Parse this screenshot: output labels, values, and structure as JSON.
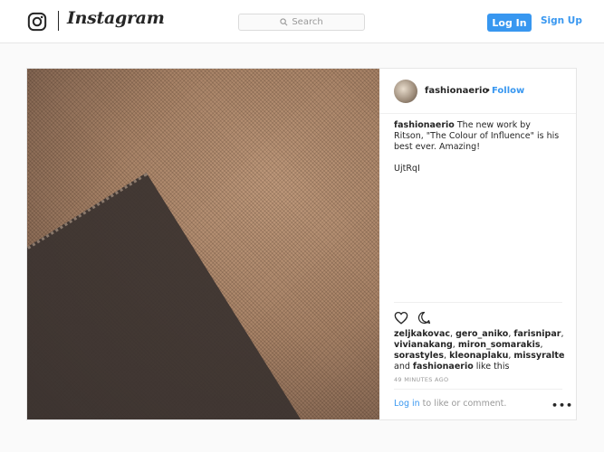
{
  "header": {
    "logo_icon": "instagram-camera-icon",
    "wordmark": "Instagram",
    "search_placeholder": "Search",
    "search_icon": "search-icon",
    "login_label": "Log In",
    "signup_label": "Sign Up"
  },
  "post": {
    "username": "fashionaerio",
    "dot": "•",
    "follow_label": "Follow",
    "caption_user": "fashionaerio",
    "caption_text": " The new work by Ritson, \"The Colour of Influence\" is his best ever. Amazing!",
    "caption_extra": "UjtRqI",
    "likes": {
      "users": [
        "zeljkakovac",
        "gero_aniko",
        "farisnipar",
        "vivianakang",
        "miron_somarakis",
        "sorastyles",
        "kleonaplaku",
        "missyralte",
        "fashionaerio"
      ],
      "and_text": "and",
      "like_suffix": "like this"
    },
    "time_ago": "49 MINUTES AGO",
    "comment_prompt": {
      "login_text": "Log in",
      "rest_text": " to like or comment."
    },
    "more_label": "•••"
  },
  "colors": {
    "accent": "#3897f0",
    "text": "#262626",
    "muted": "#999999",
    "background": "#fafafa"
  }
}
